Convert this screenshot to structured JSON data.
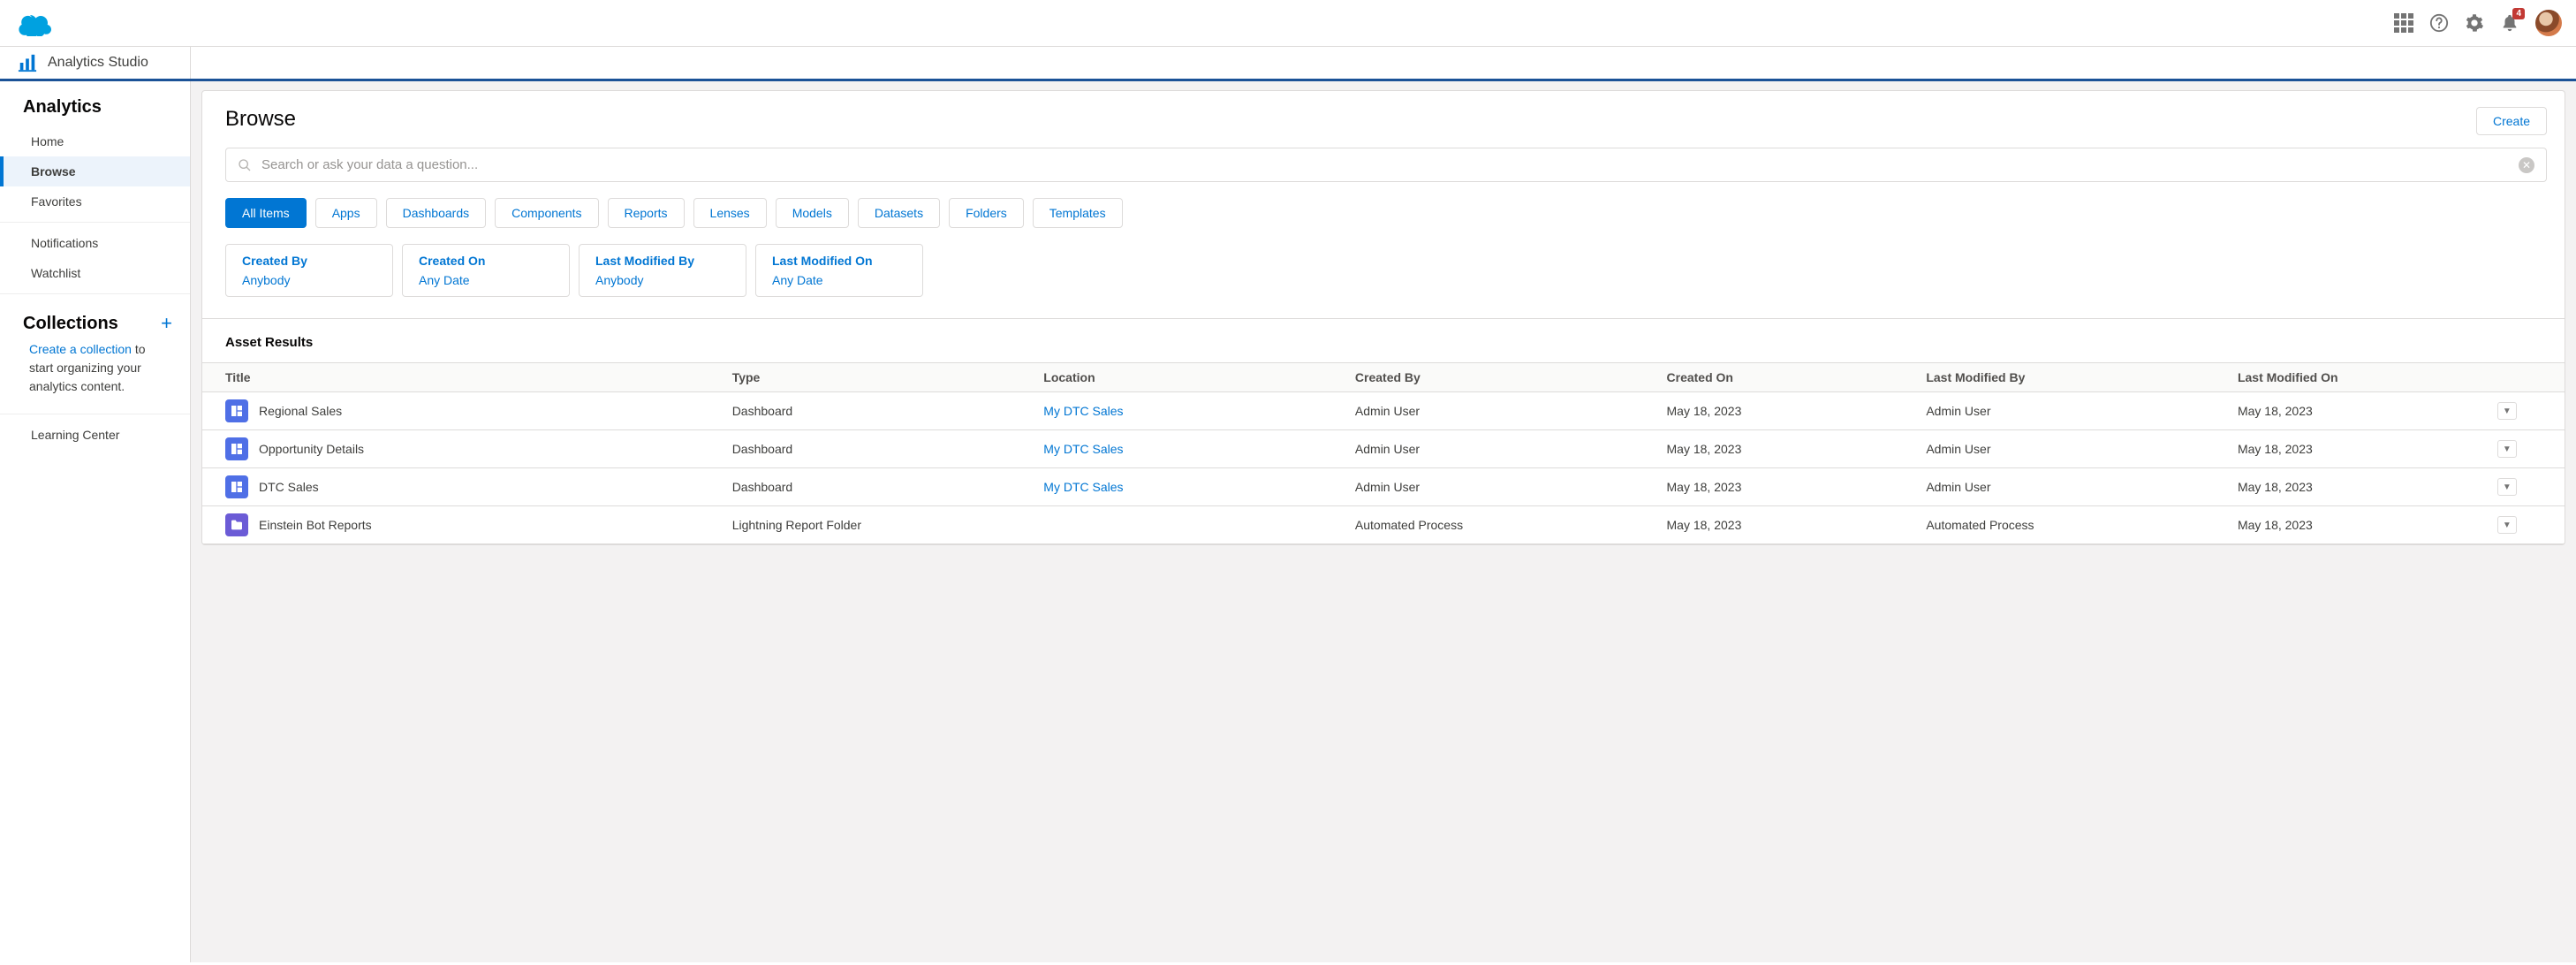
{
  "header": {
    "notification_count": "4"
  },
  "appbar": {
    "name": "Analytics Studio"
  },
  "sidebar": {
    "title": "Analytics",
    "items": [
      {
        "label": "Home",
        "active": false
      },
      {
        "label": "Browse",
        "active": true
      },
      {
        "label": "Favorites",
        "active": false
      }
    ],
    "group2": [
      {
        "label": "Notifications"
      },
      {
        "label": "Watchlist"
      }
    ],
    "collections": {
      "title": "Collections",
      "link": "Create a collection",
      "desc_rest": " to start organizing your analytics content."
    },
    "learning": {
      "label": "Learning Center"
    }
  },
  "main": {
    "title": "Browse",
    "create_label": "Create",
    "search_placeholder": "Search or ask your data a question...",
    "chips": [
      "All Items",
      "Apps",
      "Dashboards",
      "Components",
      "Reports",
      "Lenses",
      "Models",
      "Datasets",
      "Folders",
      "Templates"
    ],
    "filters": [
      {
        "label": "Created By",
        "value": "Anybody"
      },
      {
        "label": "Created On",
        "value": "Any Date"
      },
      {
        "label": "Last Modified By",
        "value": "Anybody"
      },
      {
        "label": "Last Modified On",
        "value": "Any Date"
      }
    ],
    "results_title": "Asset Results",
    "columns": [
      "Title",
      "Type",
      "Location",
      "Created By",
      "Created On",
      "Last Modified By",
      "Last Modified On",
      ""
    ],
    "rows": [
      {
        "icon": "dash",
        "title": "Regional Sales",
        "type": "Dashboard",
        "location": "My DTC Sales",
        "created_by": "Admin User",
        "created_on": "May 18, 2023",
        "modified_by": "Admin User",
        "modified_on": "May 18, 2023"
      },
      {
        "icon": "dash",
        "title": "Opportunity Details",
        "type": "Dashboard",
        "location": "My DTC Sales",
        "created_by": "Admin User",
        "created_on": "May 18, 2023",
        "modified_by": "Admin User",
        "modified_on": "May 18, 2023"
      },
      {
        "icon": "dash",
        "title": "DTC Sales",
        "type": "Dashboard",
        "location": "My DTC Sales",
        "created_by": "Admin User",
        "created_on": "May 18, 2023",
        "modified_by": "Admin User",
        "modified_on": "May 18, 2023"
      },
      {
        "icon": "folder",
        "title": "Einstein Bot Reports",
        "type": "Lightning Report Folder",
        "location": "",
        "created_by": "Automated Process",
        "created_on": "May 18, 2023",
        "modified_by": "Automated Process",
        "modified_on": "May 18, 2023"
      }
    ]
  }
}
